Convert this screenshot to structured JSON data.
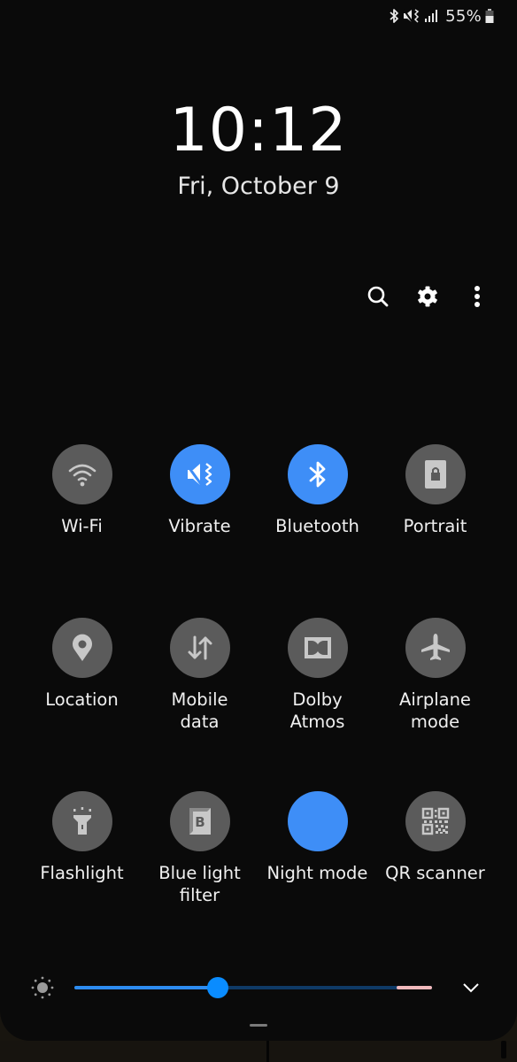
{
  "status_bar": {
    "icons": [
      "bluetooth-icon",
      "vibrate-icon",
      "signal-icon",
      "battery-icon"
    ],
    "battery_percent": "55%"
  },
  "lock": {
    "time": "10:12",
    "date": "Fri, October 9"
  },
  "toolbar": {
    "items": [
      {
        "icon": "search-icon",
        "label": "Search"
      },
      {
        "icon": "gear-icon",
        "label": "Settings"
      },
      {
        "icon": "more-vertical-icon",
        "label": "More options"
      }
    ]
  },
  "colors": {
    "tile_on": "#3e8ef7",
    "tile_off": "#5b5b5b",
    "slider_fill": "#2d8cf0",
    "slider_warn": "#f1b9bc"
  },
  "quick_settings": {
    "tiles": [
      {
        "label": "Wi-Fi",
        "icon": "wifi-icon",
        "state": "off"
      },
      {
        "label": "Vibrate",
        "icon": "vibrate-icon",
        "state": "on"
      },
      {
        "label": "Bluetooth",
        "icon": "bluetooth-icon",
        "state": "on"
      },
      {
        "label": "Portrait",
        "icon": "portrait-lock-icon",
        "state": "off"
      },
      {
        "label": "Location",
        "icon": "location-pin-icon",
        "state": "off"
      },
      {
        "label": "Mobile\ndata",
        "icon": "mobile-data-icon",
        "state": "off"
      },
      {
        "label": "Dolby\nAtmos",
        "icon": "dolby-icon",
        "state": "off"
      },
      {
        "label": "Airplane\nmode",
        "icon": "airplane-icon",
        "state": "off"
      },
      {
        "label": "Flashlight",
        "icon": "flashlight-icon",
        "state": "off"
      },
      {
        "label": "Blue light\nfilter",
        "icon": "blue-light-filter-icon",
        "state": "off"
      },
      {
        "label": "Night mode",
        "icon": "moon-icon",
        "state": "on"
      },
      {
        "label": "QR scanner",
        "icon": "qr-code-icon",
        "state": "off"
      }
    ]
  },
  "brightness": {
    "level": 0.4,
    "high_brightness_warning_from": 0.9,
    "icon": "sun-icon",
    "expand_icon": "chevron-down-icon"
  }
}
